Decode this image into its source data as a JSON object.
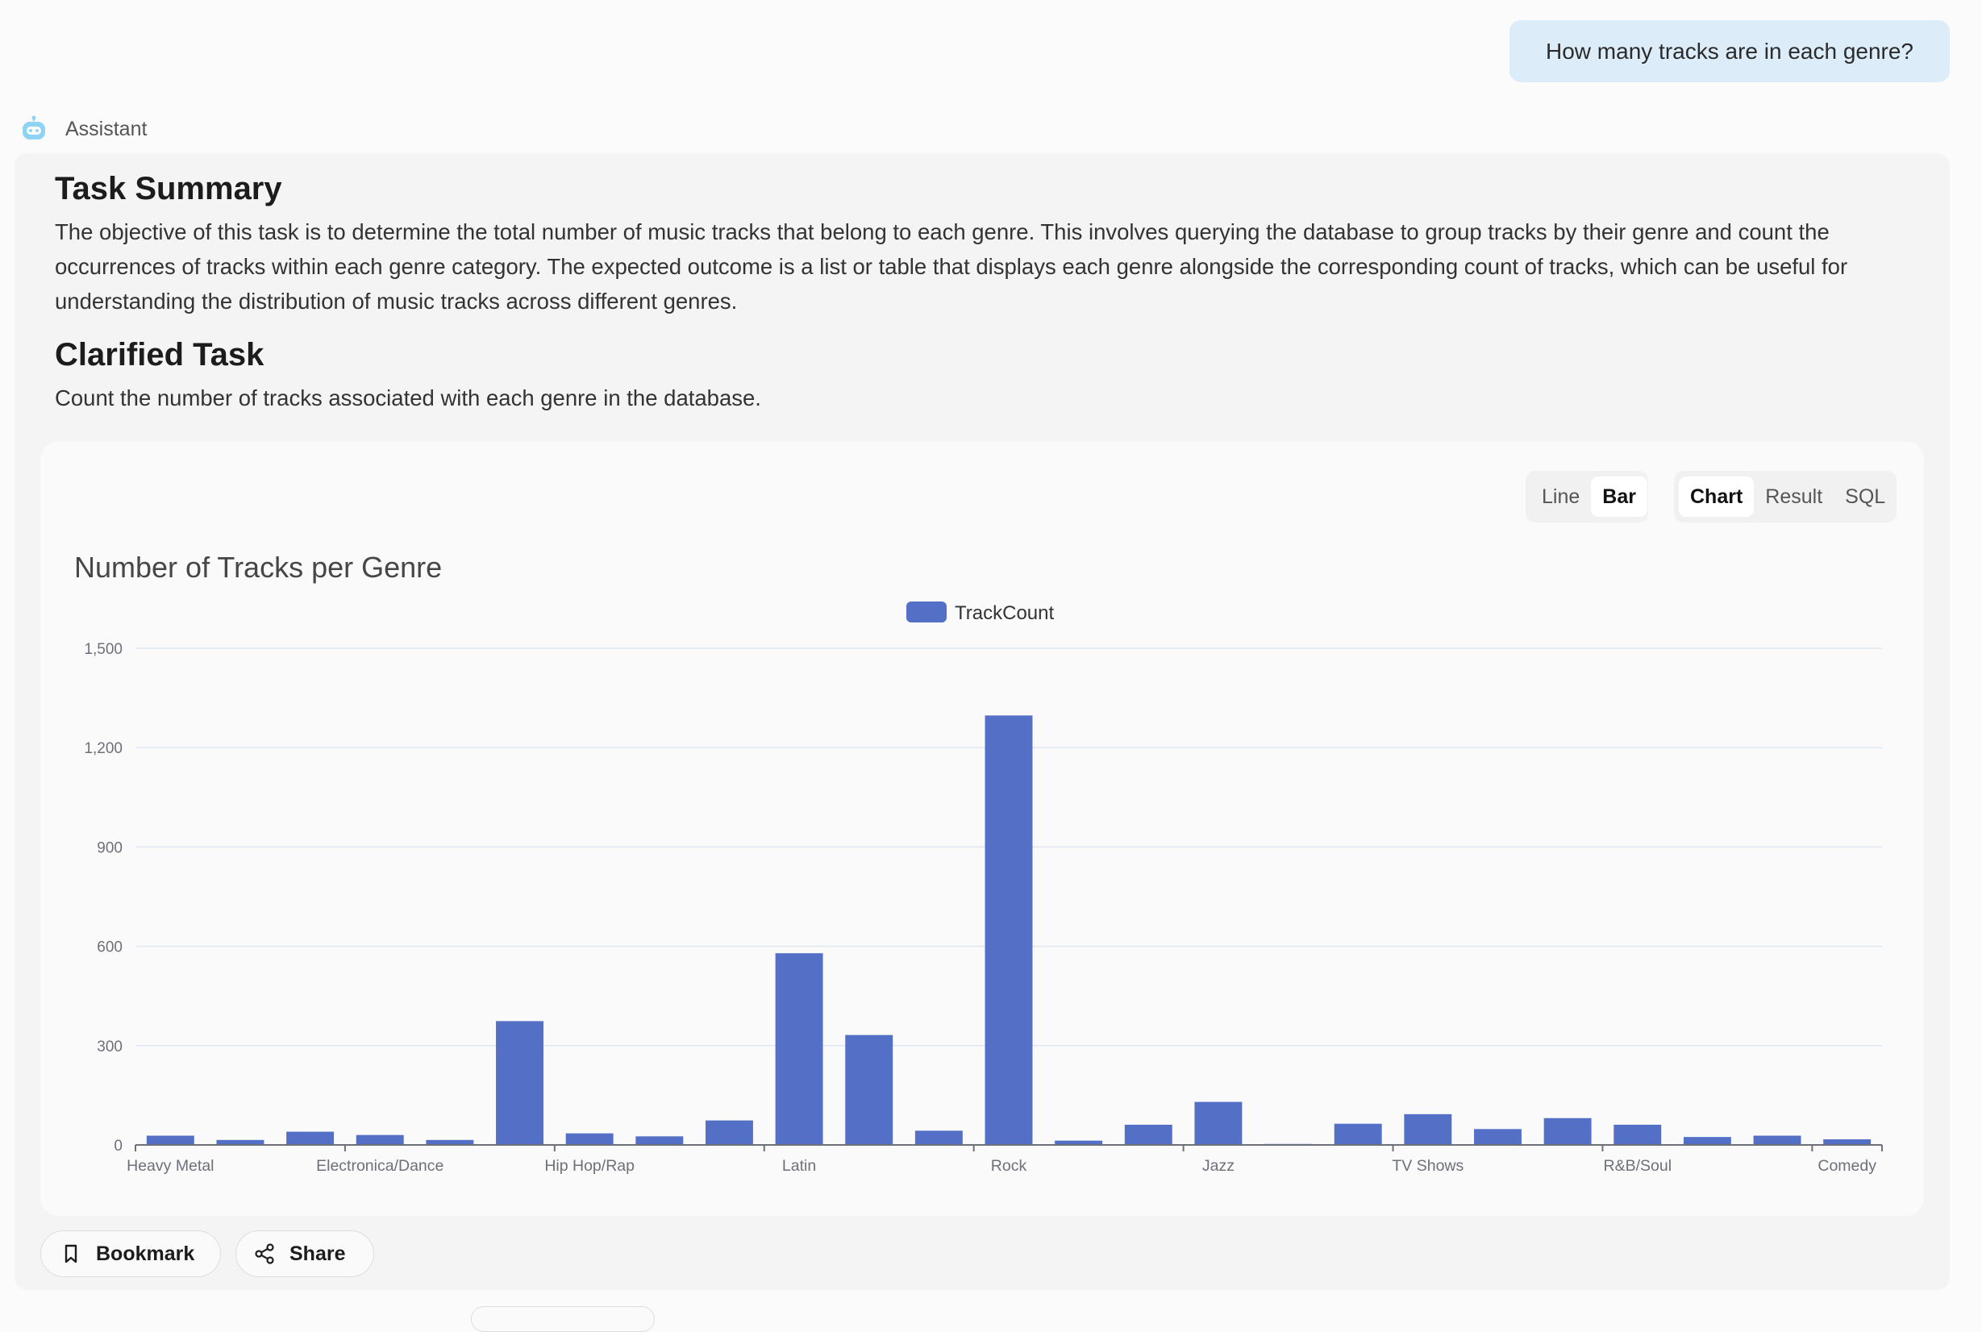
{
  "user_message": "How many tracks are in each genre?",
  "assistant_label": "Assistant",
  "task_summary": {
    "heading": "Task Summary",
    "text": "The objective of this task is to determine the total number of music tracks that belong to each genre. This involves querying the database to group tracks by their genre and count the occurrences of tracks within each genre category. The expected outcome is a list or table that displays each genre alongside the corresponding count of tracks, which can be useful for understanding the distribution of music tracks across different genres."
  },
  "clarified_task": {
    "heading": "Clarified Task",
    "text": "Count the number of tracks associated with each genre in the database."
  },
  "chart_controls": {
    "type_options": [
      "Line",
      "Bar"
    ],
    "type_selected": "Bar",
    "view_options": [
      "Chart",
      "Result",
      "SQL"
    ],
    "view_selected": "Chart"
  },
  "actions": {
    "bookmark": "Bookmark",
    "share": "Share"
  },
  "colors": {
    "bar": "#5470c6",
    "user_bubble": "#dcedf9",
    "bot_icon": "#8fd3f4"
  },
  "icons": [
    "robot-icon",
    "bookmark-icon",
    "share-icon"
  ],
  "chart_data": {
    "type": "bar",
    "title": "Number of Tracks per Genre",
    "legend": [
      "TrackCount"
    ],
    "legend_position": "top-center",
    "grid": true,
    "ylim": [
      0,
      1500
    ],
    "yticks": [
      0,
      300,
      600,
      900,
      1200,
      1500
    ],
    "ytick_labels": [
      "0",
      "300",
      "600",
      "900",
      "1,200",
      "1,500"
    ],
    "x_tick_labels": [
      "Heavy Metal",
      "Electronica/Dance",
      "Hip Hop/Rap",
      "Latin",
      "Rock",
      "Jazz",
      "TV Shows",
      "R&B/Soul",
      "Comedy"
    ],
    "x_tick_label_indices": [
      0,
      3,
      6,
      9,
      12,
      15,
      18,
      21,
      24
    ],
    "series": [
      {
        "name": "TrackCount",
        "values": [
          28,
          15,
          40,
          30,
          15,
          374,
          35,
          26,
          74,
          579,
          332,
          43,
          1297,
          13,
          61,
          130,
          3,
          64,
          93,
          48,
          81,
          61,
          24,
          28,
          17
        ]
      }
    ]
  }
}
